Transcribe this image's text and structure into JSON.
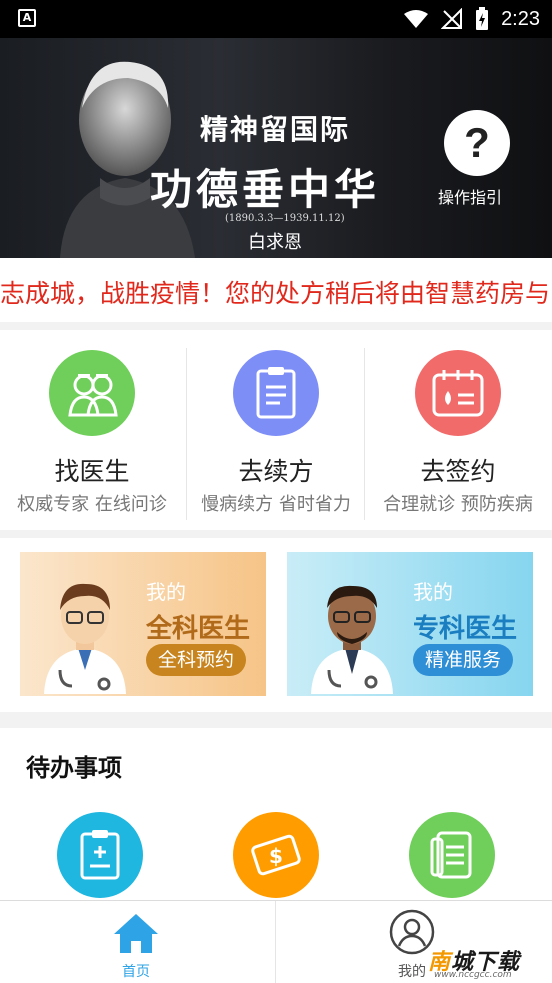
{
  "status_bar": {
    "time": "2:23",
    "left_icon": "A"
  },
  "banner": {
    "line1": "精神留国际",
    "line2": "功德垂中华",
    "dates": "(1890.3.3—1939.11.12)",
    "name": "白求恩",
    "help_label": "操作指引",
    "help_glyph": "?"
  },
  "marquee": {
    "text": "志成城，战胜疫情！您的处方稍后将由智慧药房与"
  },
  "services": [
    {
      "title": "找医生",
      "subtitle": "权威专家 在线问诊",
      "color": "#6fcf5a"
    },
    {
      "title": "去续方",
      "subtitle": "慢病续方 省时省力",
      "color": "#7e8ef7"
    },
    {
      "title": "去签约",
      "subtitle": "合理就诊 预防疾病",
      "color": "#f26b6b"
    }
  ],
  "doctor_cards": {
    "general": {
      "my": "我的",
      "kind": "全科医生",
      "pill": "全科预约"
    },
    "special": {
      "my": "我的",
      "kind": "专科医生",
      "pill": "精准服务"
    }
  },
  "todo": {
    "title": "待办事项",
    "icons": [
      {
        "name": "prescription-icon",
        "color": "#1fb6e0"
      },
      {
        "name": "payment-icon",
        "color": "#ff9d00"
      },
      {
        "name": "record-icon",
        "color": "#6fcf5a"
      }
    ]
  },
  "bottom_nav": {
    "home": "首页",
    "mine": "我的"
  },
  "watermark": {
    "text_a": "南",
    "text_b": "城下载",
    "url": "www.nccgcc.com"
  }
}
